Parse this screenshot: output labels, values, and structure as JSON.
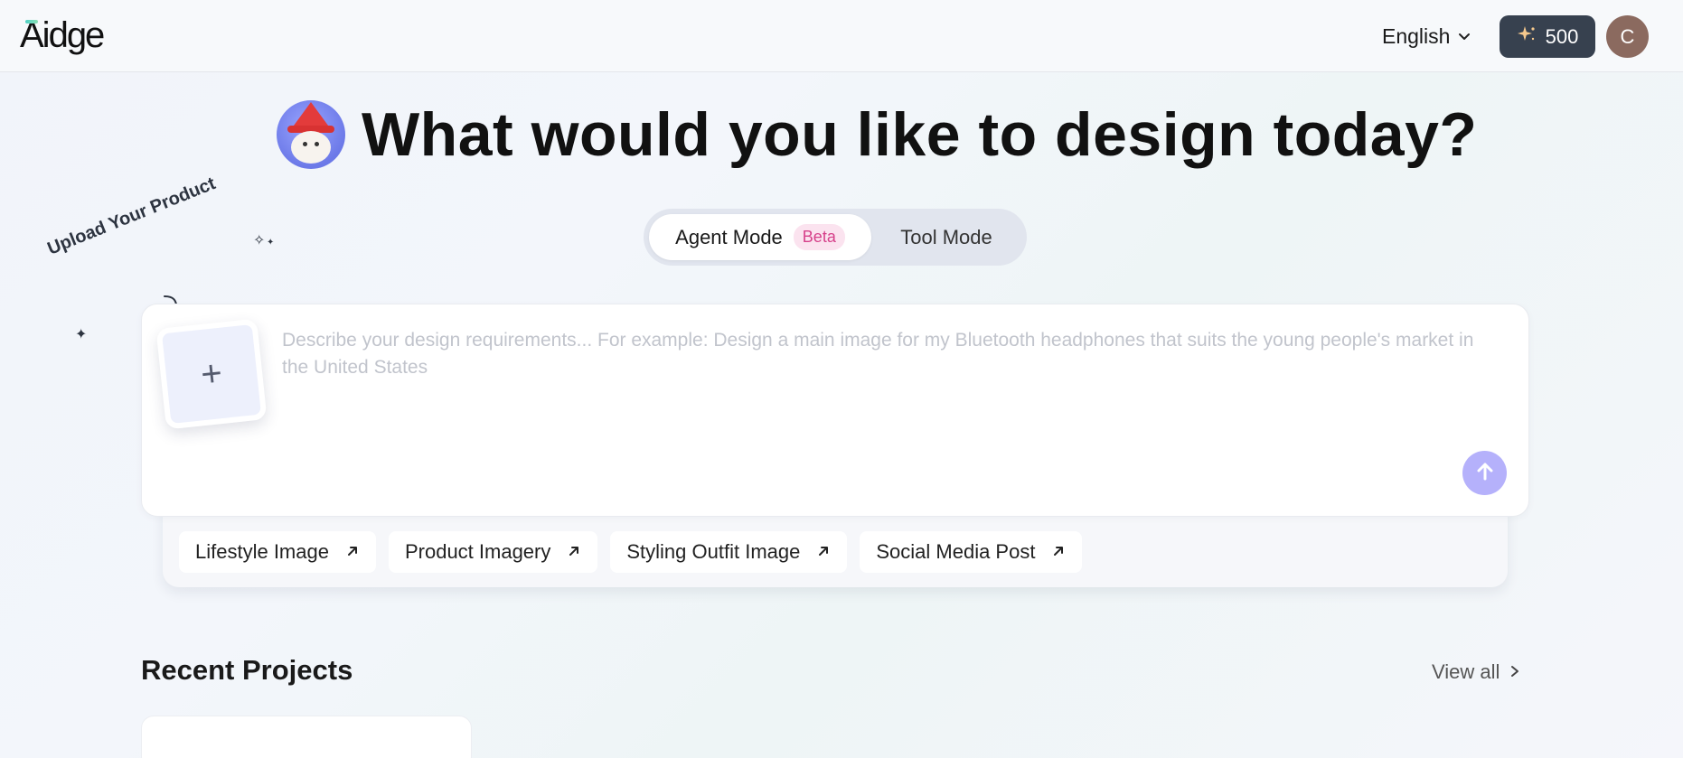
{
  "header": {
    "logo": "Aidge",
    "language": "English",
    "credits": "500",
    "avatar_initial": "C"
  },
  "hero": {
    "title": "What would you like to design today?"
  },
  "modes": {
    "agent_label": "Agent Mode",
    "agent_badge": "Beta",
    "tool_label": "Tool Mode",
    "selected": "Agent Mode"
  },
  "upload": {
    "hint": "Upload Your Product",
    "plus": "+"
  },
  "prompt": {
    "value": "",
    "placeholder": "Describe your design requirements... For example: Design a main image for my Bluetooth headphones that suits the young people's market in the United States"
  },
  "chips": [
    {
      "label": "Lifestyle Image"
    },
    {
      "label": "Product Imagery"
    },
    {
      "label": "Styling Outfit Image"
    },
    {
      "label": "Social Media Post"
    }
  ],
  "recent": {
    "title": "Recent Projects",
    "view_all": "View all"
  },
  "colors": {
    "accent_send": "#b5b1fb",
    "credits_bg": "#37414f",
    "beta_text": "#d6408a",
    "avatar_bg": "#8b6a5f"
  },
  "icons": {
    "language": "chevron-down-icon",
    "credits": "sparkle-icon",
    "send": "arrow-up-icon",
    "chip": "arrow-up-right-icon",
    "view_all": "chevron-right-icon"
  }
}
